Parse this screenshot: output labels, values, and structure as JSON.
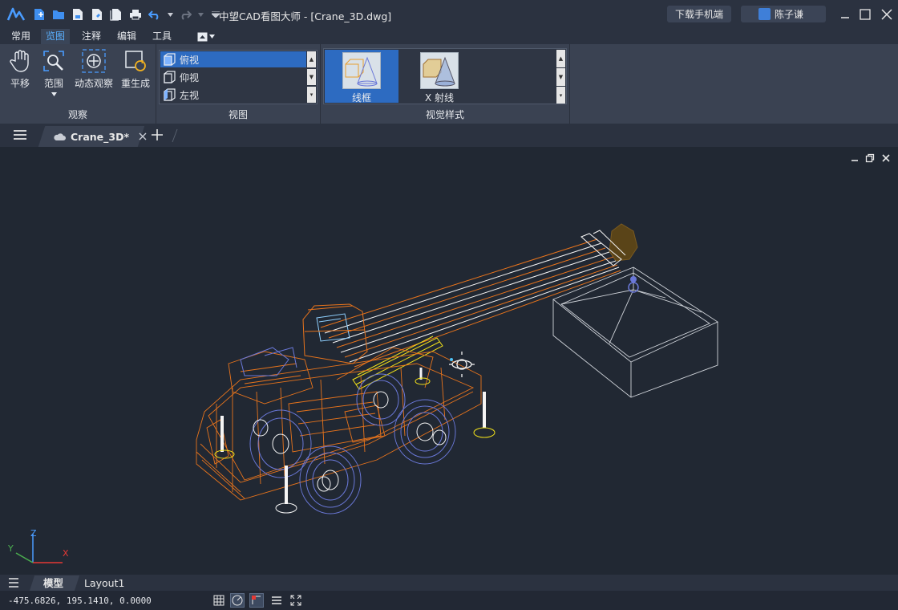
{
  "titlebar": {
    "title": "中望CAD看图大师 - [Crane_3D.dwg]",
    "download_label": "下载手机端",
    "user_name": "陈子谦"
  },
  "menu_tabs": [
    "常用",
    "览图",
    "注释",
    "编辑",
    "工具"
  ],
  "active_menu_tab": "览图",
  "ribbon": {
    "observe_panel": {
      "label": "观察",
      "buttons": [
        "平移",
        "范围",
        "动态观察",
        "重生成"
      ]
    },
    "view_panel": {
      "label": "视图",
      "items": [
        "俯视",
        "仰视",
        "左视"
      ],
      "selected": "俯视"
    },
    "visual_style_panel": {
      "label": "视觉样式",
      "items": [
        "线框",
        "X 射线"
      ],
      "selected": "线框"
    }
  },
  "document_tab": {
    "name": "Crane_3D*"
  },
  "canvas": {
    "axis_labels": {
      "x": "X",
      "y": "Y",
      "z": "Z"
    }
  },
  "layout_tabs": [
    "模型",
    "Layout1"
  ],
  "active_layout_tab": "模型",
  "status": {
    "coordinates": "-475.6826, 195.1410, 0.0000"
  },
  "colors": {
    "accent": "#2d6bc1",
    "background": "#212833",
    "wire_orange": "#e8741c",
    "wire_blue": "#6a78d8",
    "wire_yellow": "#f2e21a"
  }
}
